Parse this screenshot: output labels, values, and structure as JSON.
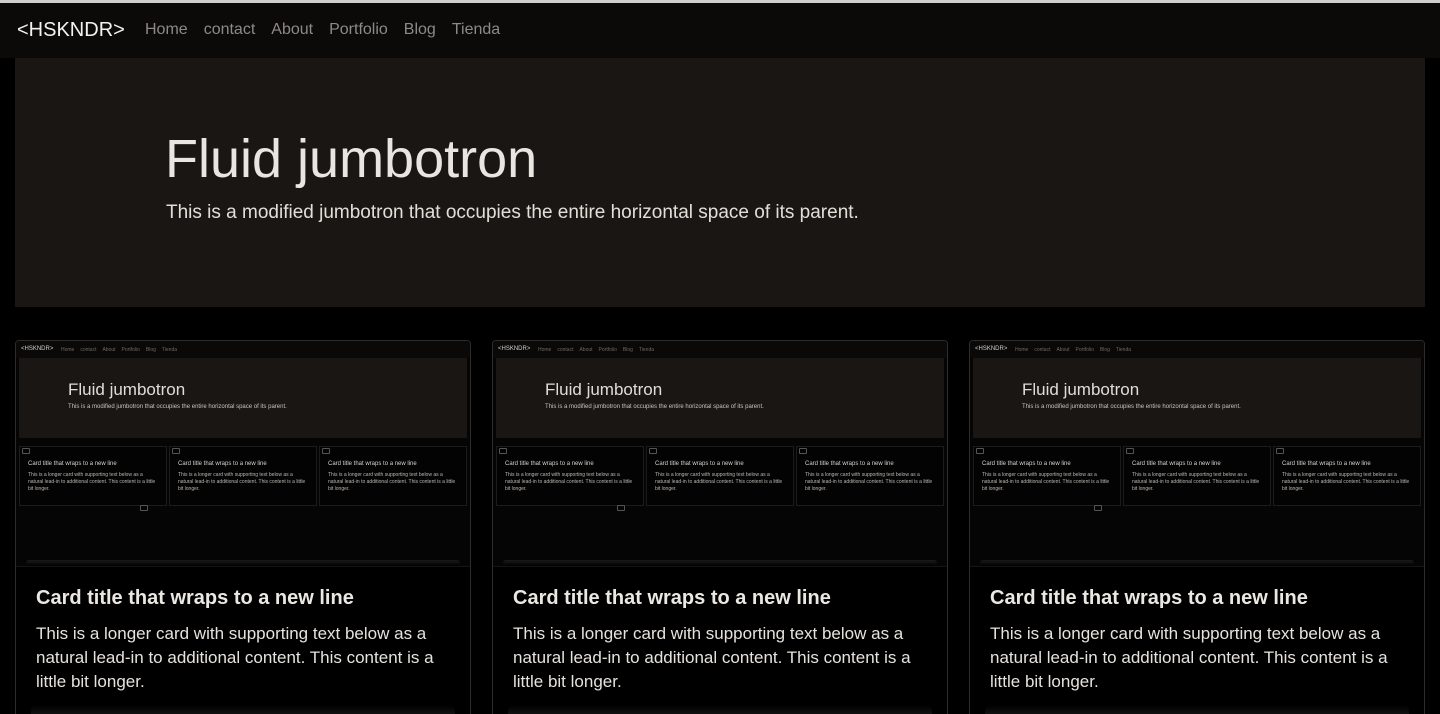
{
  "navbar": {
    "brand": "<HSKNDR>",
    "links": [
      "Home",
      "contact",
      "About",
      "Portfolio",
      "Blog",
      "Tienda"
    ]
  },
  "jumbotron": {
    "title": "Fluid jumbotron",
    "lead": "This is a modified jumbotron that occupies the entire horizontal space of its parent."
  },
  "cards": [
    {
      "title": "Card title that wraps to a new line",
      "text": "This is a longer card with supporting text below as a natural lead-in to additional content. This content is a little bit longer."
    },
    {
      "title": "Card title that wraps to a new line",
      "text": "This is a longer card with supporting text below as a natural lead-in to additional content. This content is a little bit longer."
    },
    {
      "title": "Card title that wraps to a new line",
      "text": "This is a longer card with supporting text below as a natural lead-in to additional content. This content is a little bit longer."
    }
  ],
  "thumbnail": {
    "brand": "<HSKNDR>",
    "links": [
      "Home",
      "contact",
      "About",
      "Portfolio",
      "Blog",
      "Tienda"
    ],
    "title": "Fluid jumbotron",
    "lead": "This is a modified jumbotron that occupies the entire horizontal space of its parent.",
    "card_title": "Card title that wraps to a new line",
    "card_text": "This is a longer card with supporting text below as a natural lead-in to additional content. This content is a little bit longer."
  },
  "colors": {
    "page_background": "#000000",
    "navbar_background": "#0b0a09",
    "jumbotron_background": "#1a1613",
    "nav_link": "#8d8a86"
  }
}
